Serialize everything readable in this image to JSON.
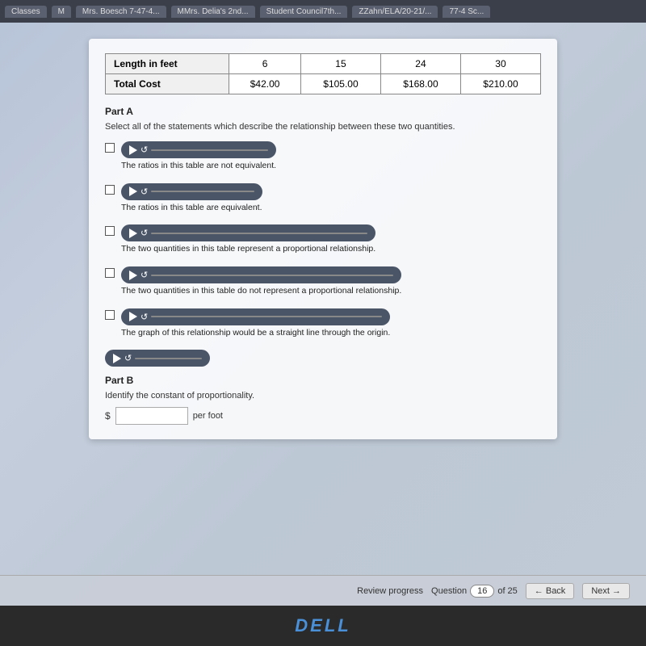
{
  "browser": {
    "tabs": [
      {
        "label": "Classes"
      },
      {
        "label": "M"
      },
      {
        "label": "Mrs. Boesch 7-47-4..."
      },
      {
        "label": "MMrs. Delia's 2nd..."
      },
      {
        "label": "Student Council7th..."
      },
      {
        "label": "ZZahn/ELA/20-21/..."
      },
      {
        "label": "77-4 Sc..."
      }
    ]
  },
  "table": {
    "row1_label": "Length in feet",
    "row2_label": "Total Cost",
    "columns": [
      {
        "length": "6",
        "cost": "$42.00"
      },
      {
        "length": "15",
        "cost": "$105.00"
      },
      {
        "length": "24",
        "cost": "$168.00"
      },
      {
        "length": "30",
        "cost": "$210.00"
      }
    ]
  },
  "partA": {
    "label": "Part A",
    "instruction": "Select all of the statements which describe the relationship between these two quantities.",
    "options": [
      {
        "text": "The ratios in this table are not equivalent."
      },
      {
        "text": "The ratios in this table are equivalent."
      },
      {
        "text": "The two quantities in this table represent a proportional relationship."
      },
      {
        "text": "The two quantities in this table do not represent a proportional relationship."
      },
      {
        "text": "The graph of this relationship would be a straight line through the origin."
      }
    ]
  },
  "partB": {
    "label": "Part B",
    "instruction": "Identify the constant of proportionality.",
    "input_placeholder": "",
    "per_foot_label": "per foot"
  },
  "footer": {
    "review_label": "Review progress",
    "question_label": "Question",
    "question_number": "16",
    "total": "of 25",
    "back_btn": "← Back",
    "next_btn": "Next →"
  },
  "dell": {
    "logo": "DELL"
  }
}
